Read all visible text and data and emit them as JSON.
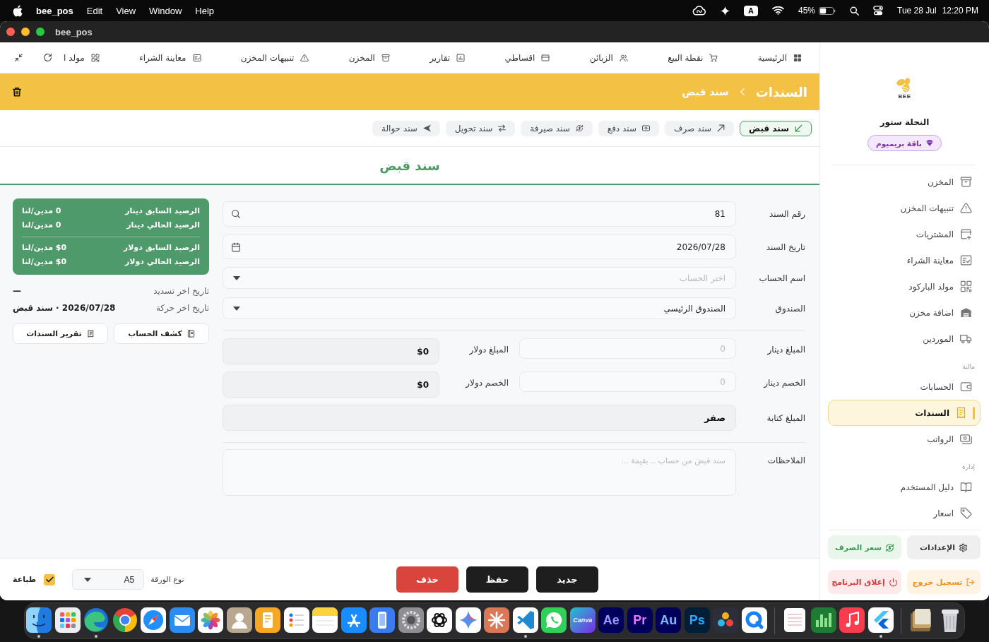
{
  "menu_bar": {
    "menus": [
      "Help",
      "Window",
      "View",
      "Edit"
    ],
    "app_name": "bee_pos",
    "input_source": "A",
    "battery": "45%",
    "date": "Tue 28 Jul",
    "time": "12:20 PM"
  },
  "window": {
    "title": "bee_pos"
  },
  "top_nav": {
    "items": [
      {
        "kind": "home",
        "label": "الرئيسية"
      },
      {
        "kind": "pos",
        "label": "نقطة البيع"
      },
      {
        "kind": "customers",
        "label": "الزبائن"
      },
      {
        "kind": "installments",
        "label": "اقساطي"
      },
      {
        "kind": "reports",
        "label": "تقارير"
      },
      {
        "kind": "store",
        "label": "المخزن"
      },
      {
        "kind": "alerts",
        "label": "تنبيهات المخزن"
      },
      {
        "kind": "preview",
        "label": "معاينة الشراء"
      },
      {
        "kind": "barcode",
        "label": "مولد ا"
      }
    ]
  },
  "header": {
    "title": "السندات",
    "current": "سند قبض"
  },
  "voucher_tabs": [
    {
      "kind": "receipt",
      "label": "سند قبض",
      "selected": true
    },
    {
      "kind": "payment",
      "label": "سند صرف",
      "selected": false
    },
    {
      "kind": "cash",
      "label": "سند دفع",
      "selected": false
    },
    {
      "kind": "exchange",
      "label": "سند صيرفة",
      "selected": false
    },
    {
      "kind": "transfer",
      "label": "سند تحويل",
      "selected": false
    },
    {
      "kind": "remit",
      "label": "سند حوالة",
      "selected": false
    }
  ],
  "page_title": "سند قبض",
  "form": {
    "rows": [
      {
        "kind": "search",
        "label": "رقم السند",
        "value": "81"
      },
      {
        "kind": "date",
        "label": "تاريخ السند",
        "value": "2026/07/28"
      },
      {
        "kind": "select",
        "label": "اسم الحساب",
        "placeholder": "اختر الحساب"
      },
      {
        "kind": "select",
        "label": "الصندوق",
        "value": "الصندوق الرئيسي"
      }
    ],
    "amounts": [
      {
        "label": "المبلغ دينار",
        "placeholder": "0",
        "usd_label": "المبلغ دولار",
        "usd_value": "$0"
      },
      {
        "label": "الخصم دينار",
        "placeholder": "0",
        "usd_label": "الخصم دولار",
        "usd_value": "$0"
      }
    ],
    "amount_words": {
      "label": "المبلغ كتابة",
      "value": "صفر"
    },
    "notes": {
      "label": "الملاحظات",
      "placeholder": "سند قبض من حساب .. بقيمة ..."
    }
  },
  "summary": {
    "balance_groups": [
      {
        "rows": [
          {
            "label": "الرصيد السابق دينار",
            "value": "0 مدين/لنا"
          },
          {
            "label": "الرصيد الحالي دينار",
            "value": "0 مدين/لنا"
          }
        ]
      },
      {
        "rows": [
          {
            "label": "الرصيد السابق دولار",
            "value": "$0 مدين/لنا"
          },
          {
            "label": "الرصيد الحالي دولار",
            "value": "$0 مدين/لنا"
          }
        ]
      }
    ],
    "history": [
      {
        "label": "تاريخ اخر تسديد",
        "value": "—"
      },
      {
        "label": "تاريخ اخر حركة",
        "value": "2026/07/28 · سند قبض"
      }
    ],
    "buttons": [
      {
        "kind": "statement",
        "label": "كشف الحساب"
      },
      {
        "kind": "report",
        "label": "تقرير السندات"
      }
    ]
  },
  "bottom_bar": {
    "actions": [
      {
        "kind": "new",
        "label": "جديد"
      },
      {
        "kind": "save",
        "label": "حفظ"
      },
      {
        "kind": "delete",
        "label": "حذف"
      }
    ],
    "paper": {
      "label": "نوع الورقة",
      "value": "A5"
    },
    "print": {
      "label": "طباعة",
      "checked": true
    }
  },
  "sidebar": {
    "logo_text": "BEE",
    "store_name": "النحلة ستور",
    "plan": "باقة بريميوم",
    "groups": [
      {
        "items": [
          {
            "kind": "store",
            "label": "المخزن",
            "selected": false
          },
          {
            "kind": "alerts",
            "label": "تنبيهات المخزن",
            "selected": false
          },
          {
            "kind": "purchases",
            "label": "المشتريات",
            "selected": false
          },
          {
            "kind": "preview",
            "label": "معاينة الشراء",
            "selected": false
          },
          {
            "kind": "barcode",
            "label": "مولد الباركود",
            "selected": false
          },
          {
            "kind": "warehouse",
            "label": "اضافة مخزن",
            "selected": false
          },
          {
            "kind": "suppliers",
            "label": "الموردين",
            "selected": false
          }
        ]
      },
      {
        "title": "مالية",
        "items": [
          {
            "kind": "accounts",
            "label": "الحسابات",
            "selected": false
          },
          {
            "kind": "vouchers",
            "label": "السندات",
            "selected": true
          },
          {
            "kind": "payroll",
            "label": "الرواتب",
            "selected": false
          }
        ]
      },
      {
        "title": "إدارة",
        "items": [
          {
            "kind": "guide",
            "label": "دليل المستخدم",
            "selected": false
          },
          {
            "kind": "prices",
            "label": "اسعار",
            "selected": false
          }
        ]
      }
    ],
    "actions": [
      {
        "kind": "settings",
        "label": "الإعدادات"
      },
      {
        "kind": "rate",
        "label": "سعر الصرف"
      },
      {
        "kind": "logout",
        "label": "تسجيل خروج"
      },
      {
        "kind": "quit",
        "label": "إغلاق البرنامج"
      }
    ]
  },
  "dock": {
    "groups": [
      {
        "apps": [
          {
            "kind": "bin",
            "running": false
          },
          {
            "kind": "stack",
            "running": false
          }
        ]
      },
      {
        "apps": [
          {
            "kind": "chevrons",
            "running": true
          },
          {
            "kind": "music",
            "running": false
          },
          {
            "kind": "bars",
            "running": false
          },
          {
            "kind": "page",
            "running": false
          }
        ]
      },
      {
        "apps": [
          {
            "kind": "ring",
            "running": false
          },
          {
            "kind": "circles",
            "running": false
          },
          {
            "kind": "azure",
            "label": "Ps",
            "running": false
          },
          {
            "kind": "cyan",
            "label": "Au",
            "running": false
          },
          {
            "kind": "magenta",
            "label": "Pr",
            "running": false
          },
          {
            "kind": "violet",
            "label": "Ae",
            "running": false
          },
          {
            "kind": "script",
            "label": "Canva",
            "running": false
          },
          {
            "kind": "chat",
            "running": false
          },
          {
            "kind": "code",
            "running": true
          },
          {
            "kind": "asterisk",
            "running": false
          },
          {
            "kind": "sparkle",
            "running": false
          },
          {
            "kind": "knot",
            "running": false
          },
          {
            "kind": "gear",
            "running": false
          },
          {
            "kind": "phone",
            "running": false
          },
          {
            "kind": "appstore",
            "running": false
          },
          {
            "kind": "notepad",
            "running": false
          },
          {
            "kind": "checklist",
            "running": false
          },
          {
            "kind": "document",
            "running": false
          },
          {
            "kind": "contact",
            "running": false
          },
          {
            "kind": "flower",
            "running": false
          },
          {
            "kind": "envelope",
            "running": false
          },
          {
            "kind": "compass",
            "running": false
          },
          {
            "kind": "wheel",
            "running": false
          },
          {
            "kind": "swirl",
            "running": true
          },
          {
            "kind": "grid",
            "running": false
          },
          {
            "kind": "face",
            "running": true
          }
        ]
      }
    ]
  }
}
